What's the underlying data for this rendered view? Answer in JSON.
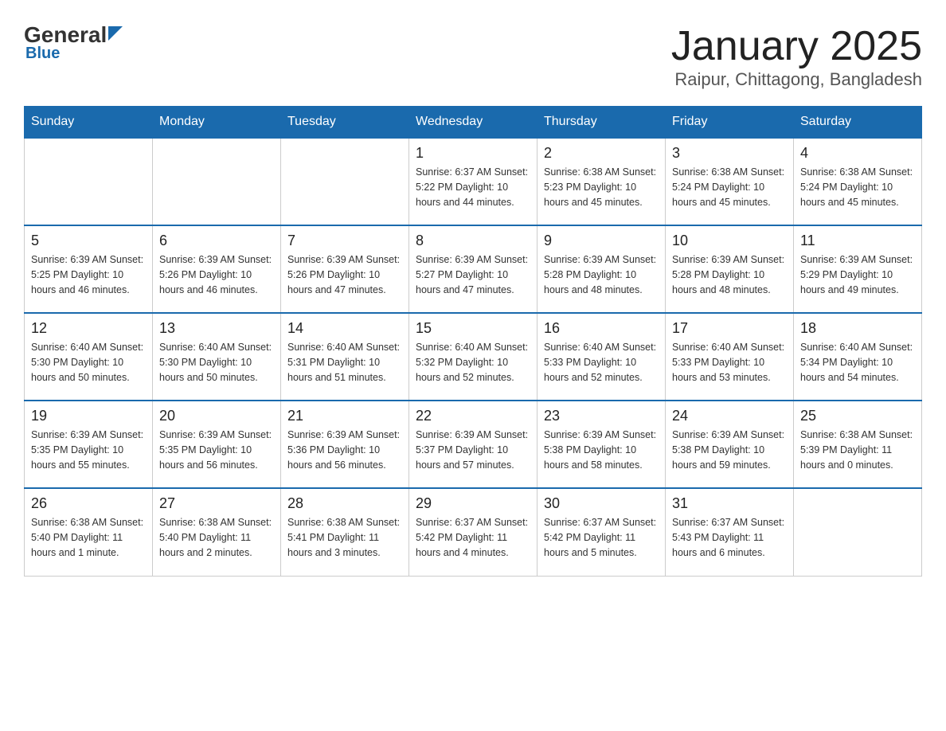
{
  "header": {
    "logo_general": "General",
    "logo_blue": "Blue",
    "title": "January 2025",
    "subtitle": "Raipur, Chittagong, Bangladesh"
  },
  "weekdays": [
    "Sunday",
    "Monday",
    "Tuesday",
    "Wednesday",
    "Thursday",
    "Friday",
    "Saturday"
  ],
  "weeks": [
    [
      {
        "day": "",
        "info": ""
      },
      {
        "day": "",
        "info": ""
      },
      {
        "day": "",
        "info": ""
      },
      {
        "day": "1",
        "info": "Sunrise: 6:37 AM\nSunset: 5:22 PM\nDaylight: 10 hours\nand 44 minutes."
      },
      {
        "day": "2",
        "info": "Sunrise: 6:38 AM\nSunset: 5:23 PM\nDaylight: 10 hours\nand 45 minutes."
      },
      {
        "day": "3",
        "info": "Sunrise: 6:38 AM\nSunset: 5:24 PM\nDaylight: 10 hours\nand 45 minutes."
      },
      {
        "day": "4",
        "info": "Sunrise: 6:38 AM\nSunset: 5:24 PM\nDaylight: 10 hours\nand 45 minutes."
      }
    ],
    [
      {
        "day": "5",
        "info": "Sunrise: 6:39 AM\nSunset: 5:25 PM\nDaylight: 10 hours\nand 46 minutes."
      },
      {
        "day": "6",
        "info": "Sunrise: 6:39 AM\nSunset: 5:26 PM\nDaylight: 10 hours\nand 46 minutes."
      },
      {
        "day": "7",
        "info": "Sunrise: 6:39 AM\nSunset: 5:26 PM\nDaylight: 10 hours\nand 47 minutes."
      },
      {
        "day": "8",
        "info": "Sunrise: 6:39 AM\nSunset: 5:27 PM\nDaylight: 10 hours\nand 47 minutes."
      },
      {
        "day": "9",
        "info": "Sunrise: 6:39 AM\nSunset: 5:28 PM\nDaylight: 10 hours\nand 48 minutes."
      },
      {
        "day": "10",
        "info": "Sunrise: 6:39 AM\nSunset: 5:28 PM\nDaylight: 10 hours\nand 48 minutes."
      },
      {
        "day": "11",
        "info": "Sunrise: 6:39 AM\nSunset: 5:29 PM\nDaylight: 10 hours\nand 49 minutes."
      }
    ],
    [
      {
        "day": "12",
        "info": "Sunrise: 6:40 AM\nSunset: 5:30 PM\nDaylight: 10 hours\nand 50 minutes."
      },
      {
        "day": "13",
        "info": "Sunrise: 6:40 AM\nSunset: 5:30 PM\nDaylight: 10 hours\nand 50 minutes."
      },
      {
        "day": "14",
        "info": "Sunrise: 6:40 AM\nSunset: 5:31 PM\nDaylight: 10 hours\nand 51 minutes."
      },
      {
        "day": "15",
        "info": "Sunrise: 6:40 AM\nSunset: 5:32 PM\nDaylight: 10 hours\nand 52 minutes."
      },
      {
        "day": "16",
        "info": "Sunrise: 6:40 AM\nSunset: 5:33 PM\nDaylight: 10 hours\nand 52 minutes."
      },
      {
        "day": "17",
        "info": "Sunrise: 6:40 AM\nSunset: 5:33 PM\nDaylight: 10 hours\nand 53 minutes."
      },
      {
        "day": "18",
        "info": "Sunrise: 6:40 AM\nSunset: 5:34 PM\nDaylight: 10 hours\nand 54 minutes."
      }
    ],
    [
      {
        "day": "19",
        "info": "Sunrise: 6:39 AM\nSunset: 5:35 PM\nDaylight: 10 hours\nand 55 minutes."
      },
      {
        "day": "20",
        "info": "Sunrise: 6:39 AM\nSunset: 5:35 PM\nDaylight: 10 hours\nand 56 minutes."
      },
      {
        "day": "21",
        "info": "Sunrise: 6:39 AM\nSunset: 5:36 PM\nDaylight: 10 hours\nand 56 minutes."
      },
      {
        "day": "22",
        "info": "Sunrise: 6:39 AM\nSunset: 5:37 PM\nDaylight: 10 hours\nand 57 minutes."
      },
      {
        "day": "23",
        "info": "Sunrise: 6:39 AM\nSunset: 5:38 PM\nDaylight: 10 hours\nand 58 minutes."
      },
      {
        "day": "24",
        "info": "Sunrise: 6:39 AM\nSunset: 5:38 PM\nDaylight: 10 hours\nand 59 minutes."
      },
      {
        "day": "25",
        "info": "Sunrise: 6:38 AM\nSunset: 5:39 PM\nDaylight: 11 hours\nand 0 minutes."
      }
    ],
    [
      {
        "day": "26",
        "info": "Sunrise: 6:38 AM\nSunset: 5:40 PM\nDaylight: 11 hours\nand 1 minute."
      },
      {
        "day": "27",
        "info": "Sunrise: 6:38 AM\nSunset: 5:40 PM\nDaylight: 11 hours\nand 2 minutes."
      },
      {
        "day": "28",
        "info": "Sunrise: 6:38 AM\nSunset: 5:41 PM\nDaylight: 11 hours\nand 3 minutes."
      },
      {
        "day": "29",
        "info": "Sunrise: 6:37 AM\nSunset: 5:42 PM\nDaylight: 11 hours\nand 4 minutes."
      },
      {
        "day": "30",
        "info": "Sunrise: 6:37 AM\nSunset: 5:42 PM\nDaylight: 11 hours\nand 5 minutes."
      },
      {
        "day": "31",
        "info": "Sunrise: 6:37 AM\nSunset: 5:43 PM\nDaylight: 11 hours\nand 6 minutes."
      },
      {
        "day": "",
        "info": ""
      }
    ]
  ]
}
